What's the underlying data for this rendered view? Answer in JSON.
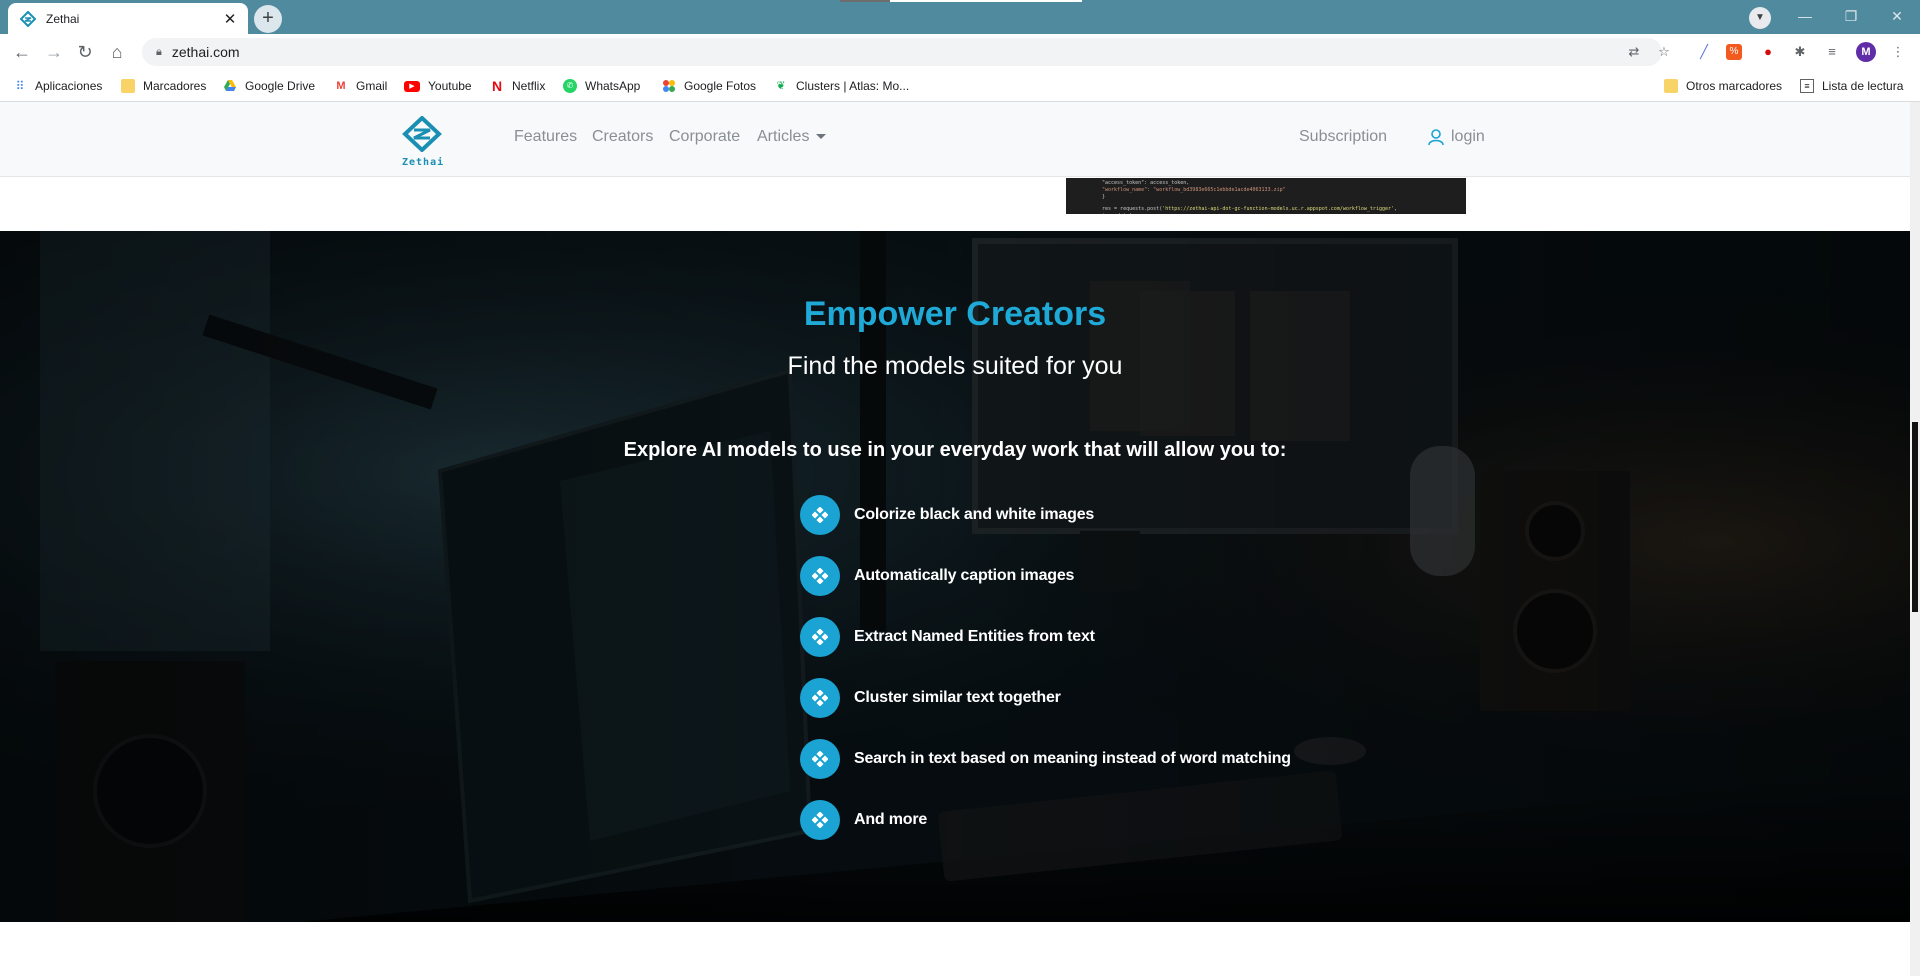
{
  "browser": {
    "tab": {
      "title": "Zethai",
      "close": "✕"
    },
    "new_tab": "+",
    "window_controls": {
      "minimize": "—",
      "restore": "❐",
      "close": "✕"
    },
    "url": "zethai.com",
    "bookmarks": [
      {
        "label": "Aplicaciones",
        "icon": "apps-grid-icon"
      },
      {
        "label": "Marcadores",
        "icon": "folder-icon"
      },
      {
        "label": "Google Drive",
        "icon": "google-drive-icon"
      },
      {
        "label": "Gmail",
        "icon": "gmail-icon"
      },
      {
        "label": "Youtube",
        "icon": "youtube-icon"
      },
      {
        "label": "Netflix",
        "icon": "netflix-icon"
      },
      {
        "label": "WhatsApp",
        "icon": "whatsapp-icon"
      },
      {
        "label": "Google Fotos",
        "icon": "google-photos-icon"
      },
      {
        "label": "Clusters | Atlas: Mo...",
        "icon": "mongodb-leaf-icon"
      }
    ],
    "bookmarks_right": [
      {
        "label": "Otros marcadores",
        "icon": "folder-icon"
      },
      {
        "label": "Lista de lectura",
        "icon": "reading-list-icon"
      }
    ],
    "profile_initial": "M"
  },
  "site": {
    "logo_text": "Zethai",
    "nav": {
      "features": "Features",
      "creators": "Creators",
      "corporate": "Corporate",
      "articles": "Articles",
      "subscription": "Subscription",
      "login": "login"
    },
    "code_peek": {
      "line1": "\"access_token\": access_token,",
      "line2": "\"workflow_name\": \"workflow_bd3983e665c1ebbde1acde4063133.zip\"",
      "line3": "}",
      "line4a": "res = requests.post(",
      "line4b": "'https://zethai-api-dot-gc-function-models.uc.r.appspot.com/workflow_trigger'",
      "line4c": ", json=data)"
    },
    "hero": {
      "title": "Empower Creators",
      "subtitle": "Find the models suited for you",
      "lead": "Explore AI models to use in your everyday work that will allow you to:",
      "features": [
        "Colorize black and white images",
        "Automatically caption images",
        "Extract Named Entities from text",
        "Cluster similar text together",
        "Search in text based on meaning instead of word matching",
        "And more"
      ]
    }
  },
  "colors": {
    "accent": "#1fa9d6",
    "tabstrip": "#4f8a9f",
    "hero_bg": "#050b10"
  }
}
